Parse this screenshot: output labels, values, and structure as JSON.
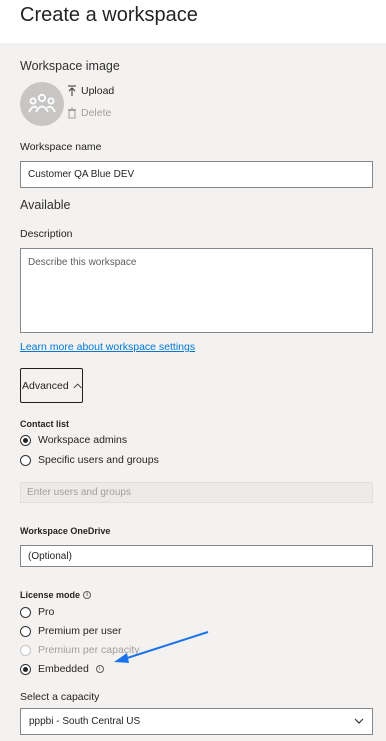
{
  "header": {
    "title": "Create a workspace"
  },
  "image_section": {
    "label": "Workspace image",
    "upload_label": "Upload",
    "delete_label": "Delete"
  },
  "name_section": {
    "label": "Workspace name",
    "value": "Customer QA Blue DEV",
    "availability": "Available"
  },
  "description_section": {
    "label": "Description",
    "placeholder": "Describe this workspace"
  },
  "settings_link": "Learn more about workspace settings",
  "advanced_button": "Advanced",
  "contact_list": {
    "label": "Contact list",
    "options": [
      "Workspace admins",
      "Specific users and groups"
    ],
    "selected": "Workspace admins",
    "users_placeholder": "Enter users and groups"
  },
  "onedrive": {
    "label": "Workspace OneDrive",
    "placeholder": "(Optional)"
  },
  "license_mode": {
    "label": "License mode",
    "options": [
      "Pro",
      "Premium per user",
      "Premium per capacity",
      "Embedded"
    ],
    "selected": "Embedded",
    "disabled_option": "Premium per capacity"
  },
  "capacity": {
    "label": "Select a capacity",
    "value": "pppbi - South Central US"
  },
  "colors": {
    "link": "#0078d4",
    "annotation_arrow": "#1a73e8",
    "panel_bg": "#f3f2f1"
  }
}
